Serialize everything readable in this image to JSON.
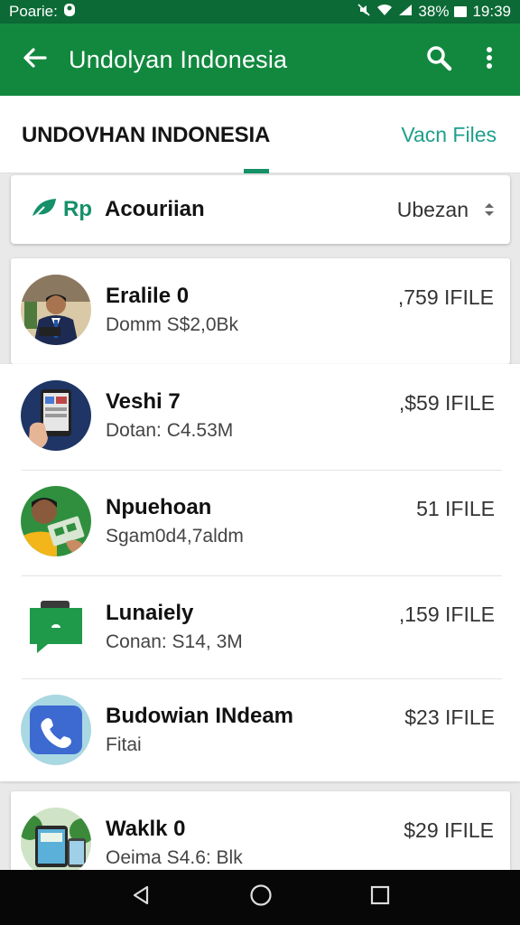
{
  "status_bar": {
    "left_text": "Poarie:",
    "battery_percent": "38%",
    "time": "19:39",
    "icons": [
      "portrait-icon",
      "mute-icon",
      "wifi-icon",
      "signal-icon",
      "battery-icon"
    ]
  },
  "app_bar": {
    "title": "Undolyan Indonesia",
    "icons": [
      "back-arrow-icon",
      "search-icon",
      "more-vert-icon"
    ]
  },
  "tab_header": {
    "title": "UNDOVHAN INDONESIA",
    "link": "Vacn Files"
  },
  "selector": {
    "currency": "Rp",
    "label": "Acouriian",
    "value": "Ubezan"
  },
  "items": [
    {
      "name": "Eralile 0",
      "subtitle": "Domm S$2,0Bk",
      "price": ",759 IFILE",
      "avatar": "man-in-suit-avatar"
    },
    {
      "name": "Veshi 7",
      "subtitle": "Dotan: C4.53M",
      "price": ",$59 IFILE",
      "avatar": "phone-in-hand-avatar"
    },
    {
      "name": "Npuehoan",
      "subtitle": "Sgam0d4,7aldm",
      "price": "51 IFILE",
      "avatar": "man-with-cash-avatar"
    },
    {
      "name": "Lunaiely",
      "subtitle": "Conan: S14, 3M",
      "price": ",159 IFILE",
      "avatar": "green-chat-icon"
    },
    {
      "name": "Budowian INdeam",
      "subtitle": "Fitai",
      "price": "$23 IFILE",
      "avatar": "phone-call-icon"
    },
    {
      "name": "Waklk 0",
      "subtitle": "Oeima S4.6: Blk",
      "price": "$29 IFILE",
      "avatar": "tablet-avatar"
    }
  ],
  "colors": {
    "status_bar": "#0c6a36",
    "app_bar": "#12883f",
    "accent": "#159069",
    "link": "#1f9f8c",
    "nav_bar": "#070707"
  }
}
